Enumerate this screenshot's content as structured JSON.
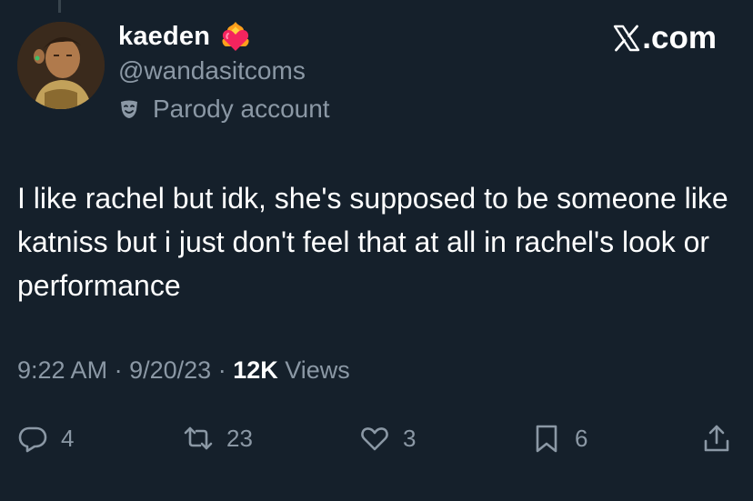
{
  "tweet": {
    "author": {
      "display_name": "kaeden",
      "handle": "@wandasitcoms",
      "badge_icon": "heart-on-fire-icon",
      "label_icon": "theater-mask-icon",
      "label": "Parody account"
    },
    "brand": ".com",
    "brand_icon": "x-logo-icon",
    "text": "I like rachel but idk, she's supposed to be someone like katniss but i just don't feel that at all in rachel's look or performance",
    "time": "9:22 AM",
    "separator": "·",
    "date": "9/20/23",
    "views_count": "12K",
    "views_label": "Views",
    "actions": {
      "replies": "4",
      "reposts": "23",
      "likes": "3",
      "bookmarks": "6"
    }
  },
  "colors": {
    "background": "#15202b",
    "text_primary": "#ffffff",
    "text_secondary": "#8b98a5",
    "heart": "#f4245e",
    "fire": "#ff9f1c"
  }
}
